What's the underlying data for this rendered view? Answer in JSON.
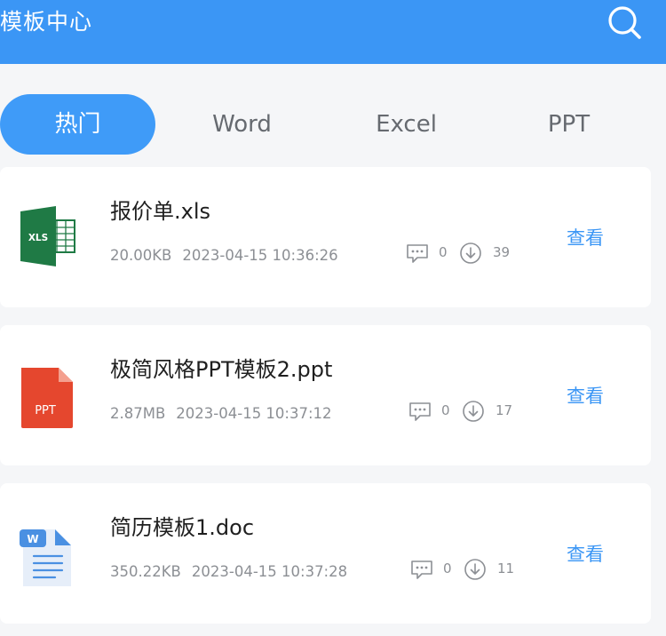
{
  "header": {
    "title": "模板中心",
    "search_icon": "search-icon"
  },
  "tabs": [
    {
      "label": "热门",
      "active": true
    },
    {
      "label": "Word",
      "active": false
    },
    {
      "label": "Excel",
      "active": false
    },
    {
      "label": "PPT",
      "active": false
    }
  ],
  "files": [
    {
      "type": "xls",
      "icon_label": "XLS",
      "name": "报价单.xls",
      "size": "20.00KB",
      "date": "2023-04-15 10:36:26",
      "comments": "0",
      "downloads": "39",
      "action_label": "查看"
    },
    {
      "type": "ppt",
      "icon_label": "PPT",
      "name": "极简风格PPT模板2.ppt",
      "size": "2.87MB",
      "date": "2023-04-15 10:37:12",
      "comments": "0",
      "downloads": "17",
      "action_label": "查看"
    },
    {
      "type": "doc",
      "icon_label": "W",
      "name": "简历模板1.doc",
      "size": "350.22KB",
      "date": "2023-04-15 10:37:28",
      "comments": "0",
      "downloads": "11",
      "action_label": "查看"
    }
  ],
  "colors": {
    "header": "#3b96f5",
    "tab_active": "#3f9bf8",
    "link": "#3b96f5",
    "xls_green": "#1f7a45",
    "ppt_red": "#e5472e",
    "doc_blue": "#4a90e2"
  }
}
